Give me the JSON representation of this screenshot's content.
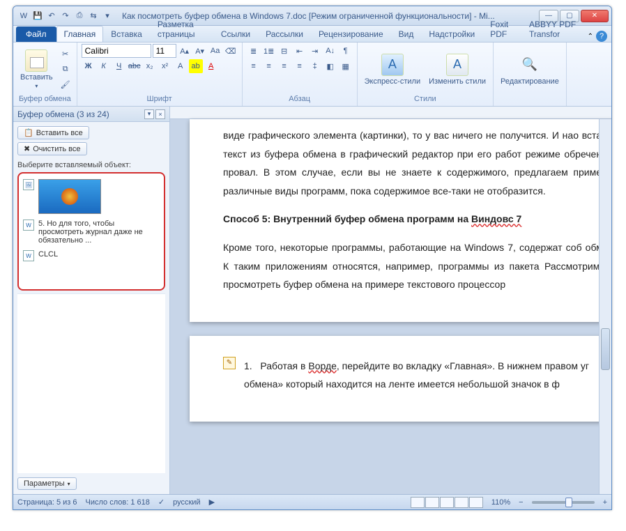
{
  "titlebar": {
    "title": "Как посмотреть буфер обмена в Windows 7.doc  [Режим ограниченной функциональности]  -  Mi..."
  },
  "tabs": {
    "file": "Файл",
    "items": [
      "Главная",
      "Вставка",
      "Разметка страницы",
      "Ссылки",
      "Рассылки",
      "Рецензирование",
      "Вид",
      "Надстройки",
      "Foxit PDF",
      "ABBYY PDF Transfor"
    ]
  },
  "ribbon": {
    "clipboard": {
      "paste": "Вставить",
      "label": "Буфер обмена"
    },
    "font": {
      "name": "Calibri",
      "size": "11",
      "label": "Шрифт"
    },
    "paragraph": {
      "label": "Абзац"
    },
    "styles": {
      "quick": "Экспресс-стили",
      "change": "Изменить стили",
      "label": "Стили"
    },
    "editing": {
      "label": "Редактирование"
    }
  },
  "pane": {
    "title": "Буфер обмена (3 из 24)",
    "paste_all": "Вставить все",
    "clear_all": "Очистить все",
    "select_label": "Выберите вставляемый объект:",
    "items": [
      {
        "type": "image"
      },
      {
        "type": "text",
        "text": "5. Но для того, чтобы просмотреть журнал даже не обязательно ..."
      },
      {
        "type": "text",
        "text": "CLCL"
      }
    ],
    "options": "Параметры"
  },
  "document": {
    "p1": "виде графического элемента (картинки), то у вас ничего не получится. И нао вставить текст из буфера обмена в графический редактор при его работ режиме обречена на провал. В этом случае, если вы не знаете к содержимого, предлагаем применять различные виды программ, пока содержимое все-таки не отобразится.",
    "h": "Способ 5: Внутренний буфер обмена программ на ",
    "h_uline": "Виндовс 7",
    "p2": "Кроме того, некоторые программы, работающие на Windows 7, содержат соб обмена. К таким приложениям относятся, например, программы из пакета Рассмотрим, как просмотреть буфер обмена на примере текстового процессор",
    "li_pre": "Работая в ",
    "li_uline": "Ворде",
    "li_post": ", перейдите во вкладку «Главная». В нижнем правом уг",
    "li2": "обмена»  который находится на ленте  имеется небольшой значок в ф",
    "num": "1."
  },
  "status": {
    "page": "Страница: 5 из 6",
    "words": "Число слов: 1 618",
    "lang": "русский",
    "zoom": "110%"
  }
}
